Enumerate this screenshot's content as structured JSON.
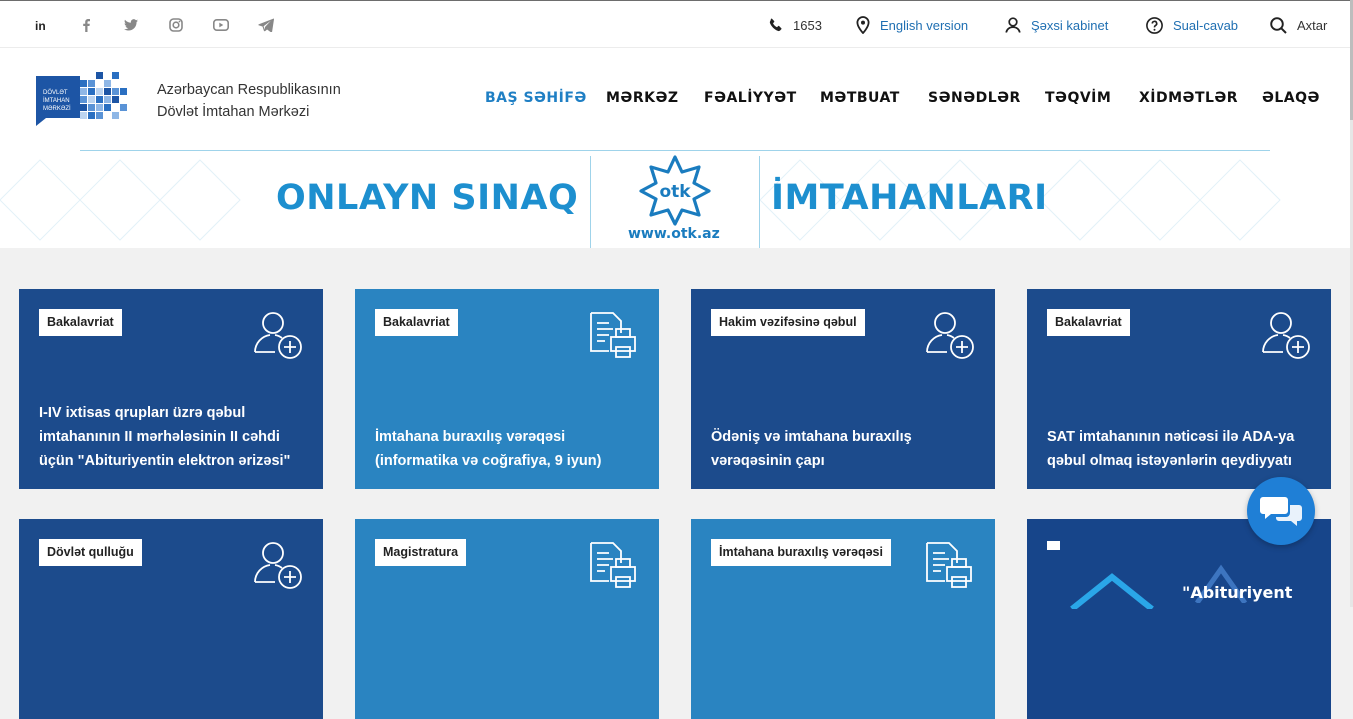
{
  "topbar": {
    "social": [
      "linkedin-icon",
      "facebook-icon",
      "twitter-icon",
      "instagram-icon",
      "youtube-icon",
      "telegram-icon"
    ],
    "phone": "1653",
    "english": "English version",
    "cabinet": "Şəxsi kabinet",
    "faq": "Sual-cavab",
    "search": "Axtar"
  },
  "header": {
    "logo_text": [
      "DÖVLƏT",
      "İMTAHAN",
      "MƏRKƏZİ"
    ],
    "title_line1": "Azərbaycan Respublikasının",
    "title_line2": "Dövlət İmtahan Mərkəzi",
    "nav": [
      "BAŞ SƏHİFƏ",
      "MƏRKƏZ",
      "FƏALİYYƏT",
      "MƏTBUAT",
      "SƏNƏDLƏR",
      "TƏQVİM",
      "XİDMƏTLƏR",
      "ƏLAQƏ"
    ],
    "active_nav": "BAŞ SƏHİFƏ"
  },
  "banner": {
    "left": "ONLAYN SINAQ",
    "right": "İMTAHANLARI",
    "logo": "otk",
    "url": "www.otk.az"
  },
  "cards": [
    {
      "badge": "Bakalavriat",
      "title": "I-IV ixtisas qrupları üzrə qəbul imtahanının II mərhələsinin II cəhdi üçün \"Abituriyentin elektron ərizəsi\"",
      "icon": "user-add-icon",
      "tone": "dark"
    },
    {
      "badge": "Bakalavriat",
      "title": "İmtahana buraxılış vərəqəsi (informatika və coğrafiya, 9 iyun)",
      "icon": "document-print-icon",
      "tone": "light"
    },
    {
      "badge": "Hakim vəzifəsinə qəbul",
      "title": "Ödəniş və imtahana buraxılış vərəqəsinin çapı",
      "icon": "user-add-icon",
      "tone": "dark"
    },
    {
      "badge": "Bakalavriat",
      "title": "SAT imtahanının nəticəsi ilə ADA-ya qəbul olmaq istəyənlərin qeydiyyatı",
      "icon": "user-add-icon",
      "tone": "dark"
    },
    {
      "badge": "Dövlət qulluğu",
      "title": "",
      "icon": "user-add-icon",
      "tone": "dark"
    },
    {
      "badge": "Magistratura",
      "title": "",
      "icon": "document-print-icon",
      "tone": "light"
    },
    {
      "badge": "İmtahana buraxılış vərəqəsi",
      "title": "",
      "icon": "document-print-icon",
      "tone": "light"
    }
  ],
  "promo": {
    "text": "\"Abituriyent"
  },
  "colors": {
    "accent": "#1f7fc4",
    "card_dark": "#1c4b8c",
    "card_light": "#2a84c1",
    "chat": "#1f7fd6"
  }
}
